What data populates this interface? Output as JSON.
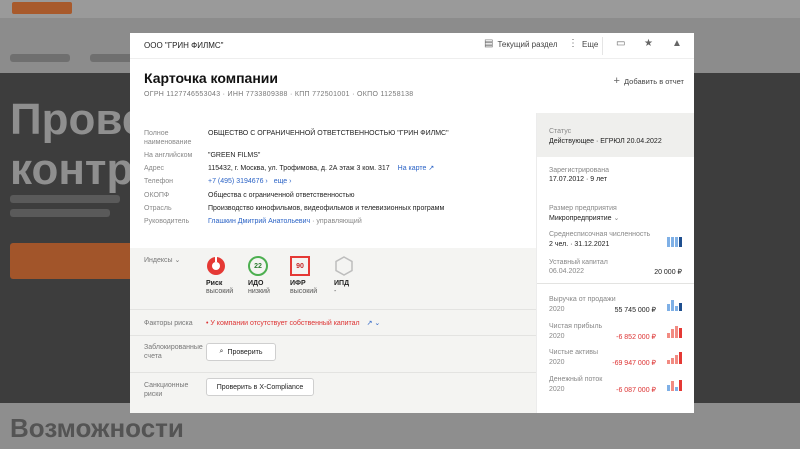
{
  "modal": {
    "org_short": "ООО \"ГРИН ФИЛМС\"",
    "toolbar": {
      "current_section": "Текущий раздел",
      "more": "Еще"
    },
    "title": "Карточка компании",
    "ids_line": "ОГРН 1127746553043 · ИНН 7733809388 · КПП 772501001 · ОКПО 11258138",
    "add_to_report": "Добавить в отчет",
    "info": {
      "full_name_label": "Полное наименование",
      "full_name": "ОБЩЕСТВО С ОГРАНИЧЕННОЙ ОТВЕТСТВЕННОСТЬЮ \"ГРИН ФИЛМС\"",
      "english_label": "На английском",
      "english": "\"GREEN FILMS\"",
      "address_label": "Адрес",
      "address": "115432, г. Москва, ул. Трофимова, д. 2А этаж 3 ком. 317",
      "on_map": "На карте",
      "phone_label": "Телефон",
      "phone": "+7 (495) 3194676",
      "phone_more": "еще",
      "okopf_label": "ОКОПФ",
      "okopf": "Общества с ограниченной ответственностью",
      "industry_label": "Отрасль",
      "industry": "Производство кинофильмов, видеофильмов и телевизионных программ",
      "head_label": "Руководитель",
      "head_name": "Глашкин Дмитрий Анатольевич",
      "head_role": "· управляющий"
    },
    "indices": {
      "label": "Индексы",
      "items": [
        {
          "name": "Риск",
          "status": "высокий",
          "value": "",
          "color": "#e53935"
        },
        {
          "name": "ИДО",
          "status": "низкий",
          "value": "22",
          "color": "#4caf50"
        },
        {
          "name": "ИФР",
          "status": "высокий",
          "value": "90",
          "color": "#e53935"
        },
        {
          "name": "ИПД",
          "status": "-",
          "value": "",
          "color": "#bdbdbd"
        }
      ]
    },
    "risk_factors": {
      "label": "Факторы риска",
      "text": "У компании отсутствует собственный капитал"
    },
    "blocked_accounts": {
      "label": "Заблокированные счета",
      "button": "Проверить"
    },
    "sanctions": {
      "label": "Санкционные риски",
      "button": "Проверить в X-Compliance"
    },
    "right": {
      "status_label": "Статус",
      "status_value": "Действующее · ЕГРЮЛ 20.04.2022",
      "registered_label": "Зарегистрирована",
      "registered_value": "17.07.2012 · 9 лет",
      "size_label": "Размер предприятия",
      "size_value": "Микропредприятие",
      "headcount_label": "Среднесписочная численность",
      "headcount_value": "2 чел. · 31.12.2021",
      "capital_label": "Уставный капитал",
      "capital_date": "06.04.2022",
      "capital_value": "20 000 ₽",
      "revenue_label": "Выручка от продажи",
      "revenue_year": "2020",
      "revenue_value": "55 745 000 ₽",
      "profit_label": "Чистая прибыль",
      "profit_year": "2020",
      "profit_value": "-6 852 000 ₽",
      "assets_label": "Чистые активы",
      "assets_year": "2020",
      "assets_value": "-69 947 000 ₽",
      "cashflow_label": "Денежный поток",
      "cashflow_year": "2020",
      "cashflow_value": "-6 087 000 ₽"
    }
  },
  "background": {
    "hero_title_1": "Прове",
    "hero_title_2": "контр",
    "bottom_title": "Возможности"
  },
  "colors": {
    "accent_red": "#e53935",
    "link_blue": "#2b63c6",
    "bar_blue": "#7fb0e6",
    "bar_dark": "#1f4f8f",
    "bar_red": "#f28b82"
  }
}
